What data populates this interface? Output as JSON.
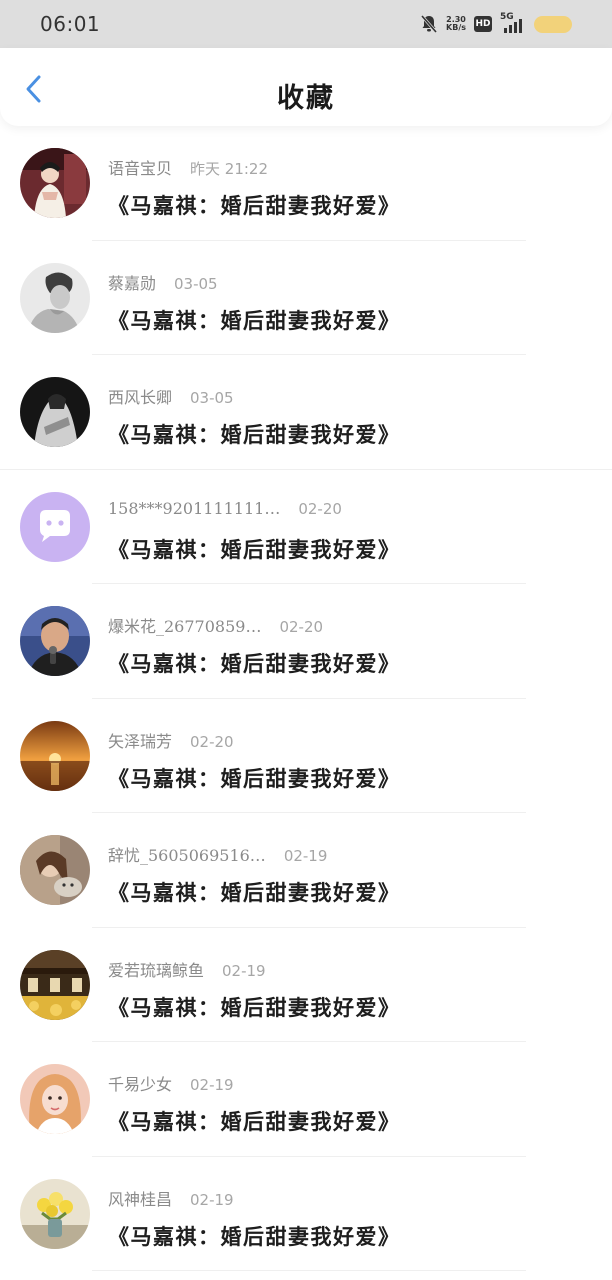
{
  "status_bar": {
    "time": "06:01",
    "net_speed_value": "2.30",
    "net_speed_unit": "KB/s",
    "hd_label": "HD",
    "signal_label": "5G"
  },
  "header": {
    "title": "收藏"
  },
  "favorites": [
    {
      "name": "语音宝贝",
      "time": "昨天 21:22",
      "book": "《马嘉祺：婚后甜妻我好爱》",
      "avatar": "avatar-woman-costume"
    },
    {
      "name": "蔡嘉勋",
      "time": "03-05",
      "book": "《马嘉祺：婚后甜妻我好爱》",
      "avatar": "avatar-monochrome-boy"
    },
    {
      "name": "西风长卿",
      "time": "03-05",
      "book": "《马嘉祺：婚后甜妻我好爱》",
      "avatar": "avatar-dark-figure"
    },
    {
      "name": "158***9201111111…",
      "time": "02-20",
      "book": "《马嘉祺：婚后甜妻我好爱》",
      "avatar": "avatar-default-chat"
    },
    {
      "name": "爆米花_26770859…",
      "time": "02-20",
      "book": "《马嘉祺：婚后甜妻我好爱》",
      "avatar": "avatar-man-microphone"
    },
    {
      "name": "矢泽瑞芳",
      "time": "02-20",
      "book": "《马嘉祺：婚后甜妻我好爱》",
      "avatar": "avatar-sunset"
    },
    {
      "name": "辞忧_5605069516…",
      "time": "02-19",
      "book": "《马嘉祺：婚后甜妻我好爱》",
      "avatar": "avatar-girl-cat"
    },
    {
      "name": "爱若琉璃鲸鱼",
      "time": "02-19",
      "book": "《马嘉祺：婚后甜妻我好爱》",
      "avatar": "avatar-building"
    },
    {
      "name": "千易少女",
      "time": "02-19",
      "book": "《马嘉祺：婚后甜妻我好爱》",
      "avatar": "avatar-girl-selfie"
    },
    {
      "name": "风神桂昌",
      "time": "02-19",
      "book": "《马嘉祺：婚后甜妻我好爱》",
      "avatar": "avatar-flowers"
    }
  ],
  "colors": {
    "accent": "#4a90e2",
    "status_bar_bg": "#dedede",
    "battery": "#f2d27a",
    "default_avatar": "#c9b3f2"
  }
}
